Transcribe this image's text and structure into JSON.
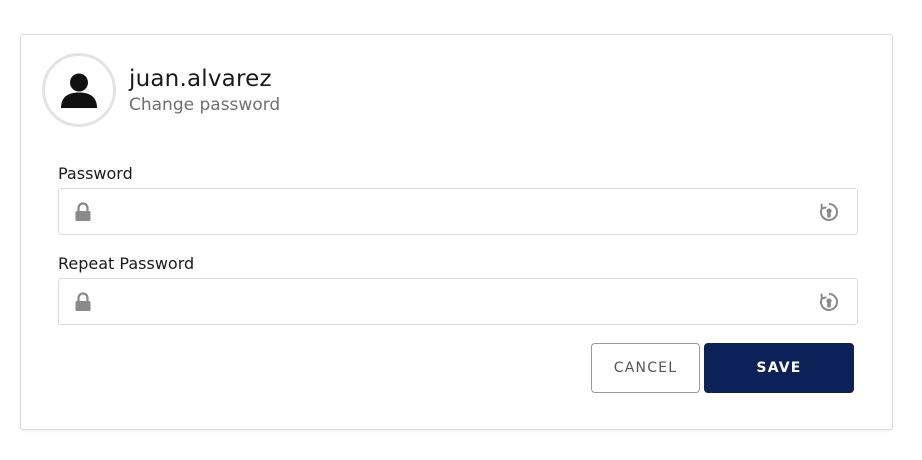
{
  "profile": {
    "username": "juan.alvarez",
    "subtitle": "Change password"
  },
  "form": {
    "password": {
      "label": "Password",
      "value": "",
      "placeholder": ""
    },
    "repeat_password": {
      "label": "Repeat Password",
      "value": "",
      "placeholder": ""
    }
  },
  "actions": {
    "cancel_label": "CANCEL",
    "save_label": "SAVE"
  },
  "icons": {
    "avatar": "user-avatar-icon",
    "lock": "lock-icon",
    "reveal": "eye-reveal-icon"
  },
  "colors": {
    "primary": "#0b2158",
    "border": "#dcdcdc",
    "muted_text": "#707070"
  }
}
